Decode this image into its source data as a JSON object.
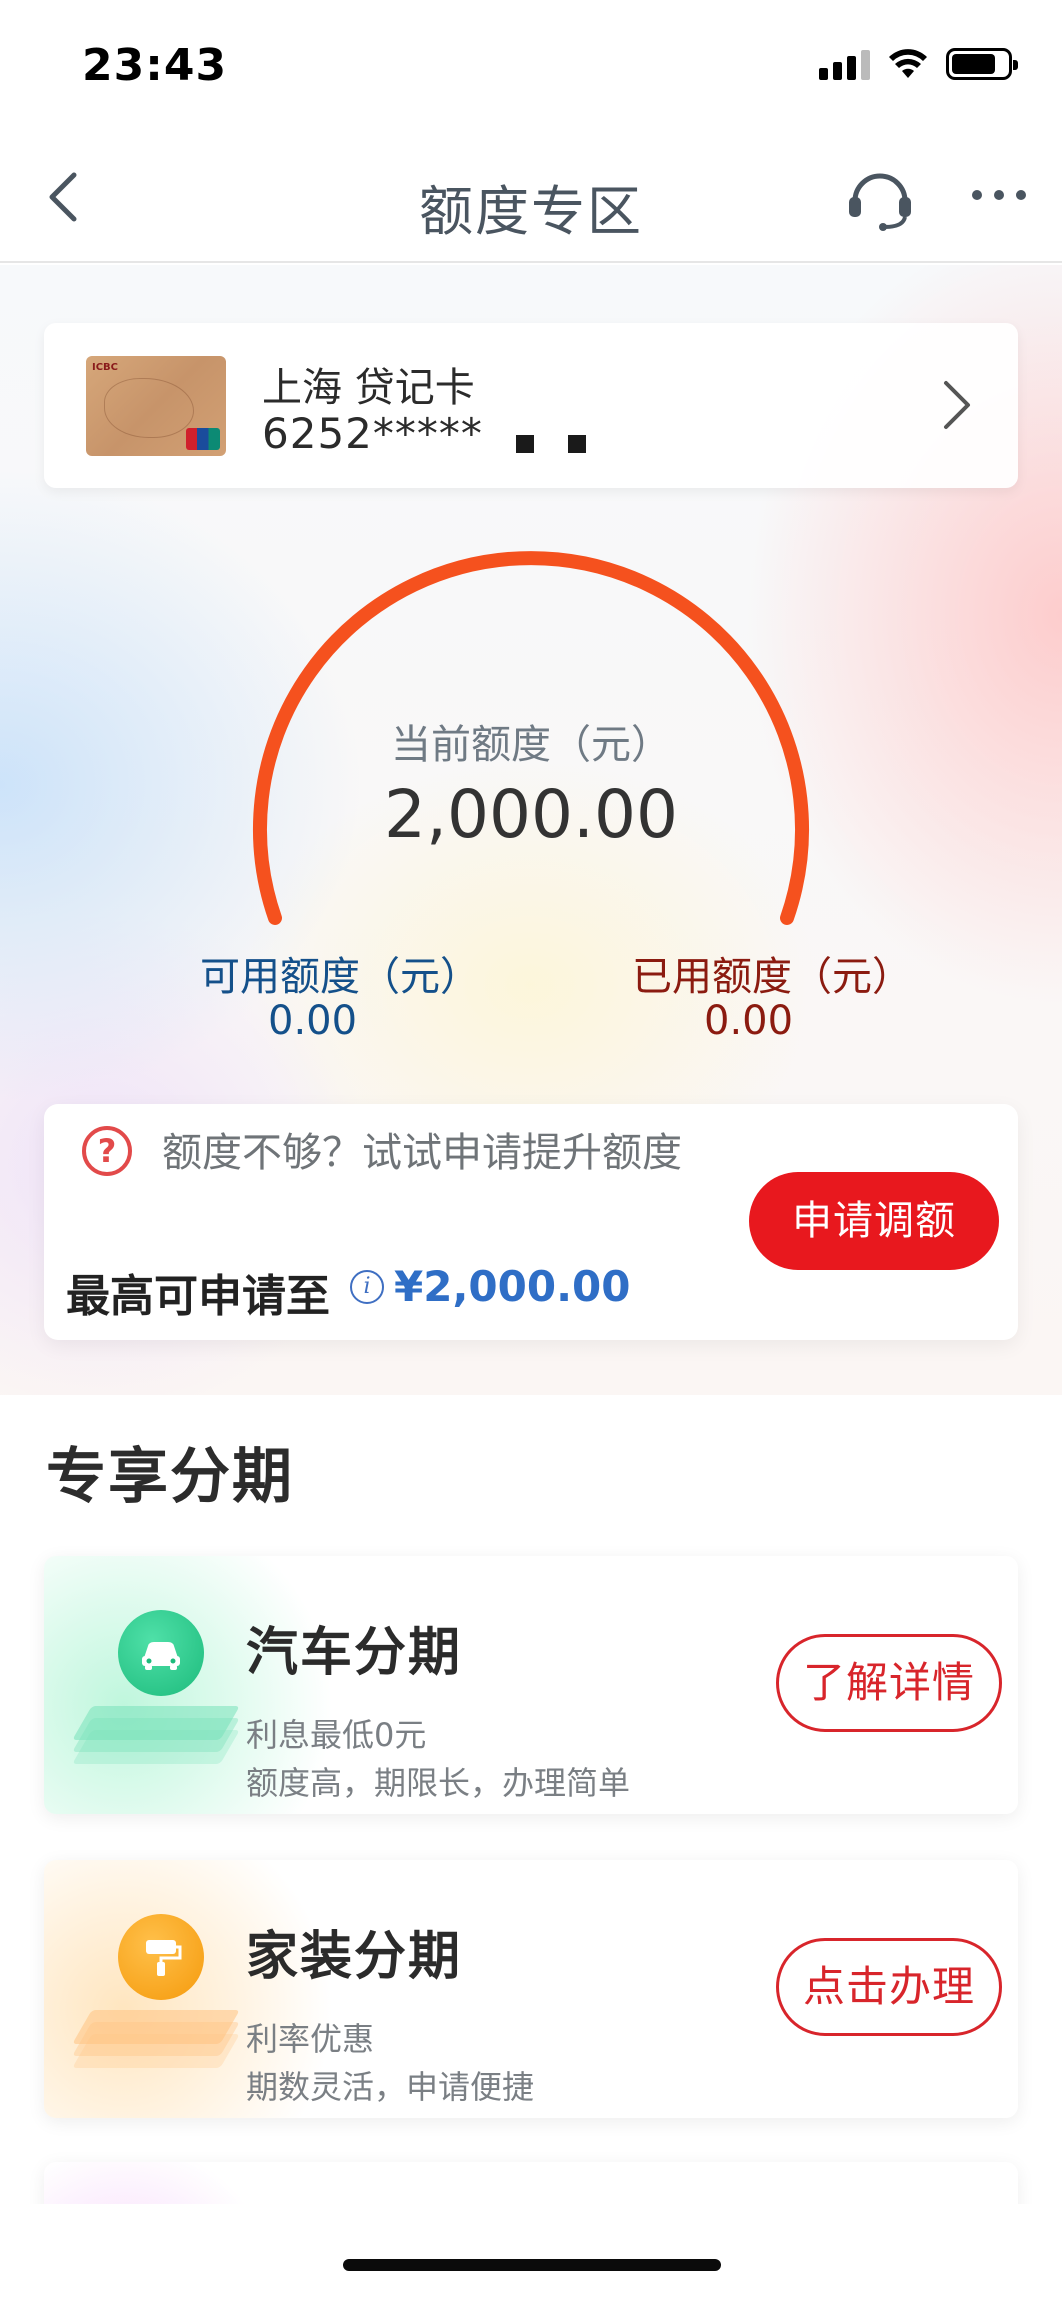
{
  "status_bar": {
    "time": "23:43"
  },
  "nav": {
    "title": "额度专区"
  },
  "card": {
    "name": "上海 贷记卡",
    "number_masked": "6252*****"
  },
  "gauge": {
    "label": "当前额度（元）",
    "value": "2,000.00",
    "available_label": "可用额度（元）",
    "available_value": "0.00",
    "used_label": "已用额度（元）",
    "used_value": "0.00",
    "arc_color": "#f5511e"
  },
  "raise": {
    "tip": "额度不够？试试申请提升额度",
    "max_label": "最高可申请至",
    "max_value": "¥2,000.00",
    "button": "申请调额"
  },
  "section": {
    "title": "专享分期"
  },
  "promos": [
    {
      "title": "汽车分期",
      "line1": "利息最低0元",
      "line2": "额度高，期限长，办理简单",
      "button": "了解详情",
      "icon": "car-icon"
    },
    {
      "title": "家装分期",
      "line1": "利率优惠",
      "line2": "期数灵活，申请便捷",
      "button": "点击办理",
      "icon": "paint-roller-icon"
    }
  ],
  "colors": {
    "accent_red": "#e8181e",
    "available_blue": "#14508a",
    "used_red": "#8b1b10",
    "link_blue": "#2f6ec6"
  }
}
